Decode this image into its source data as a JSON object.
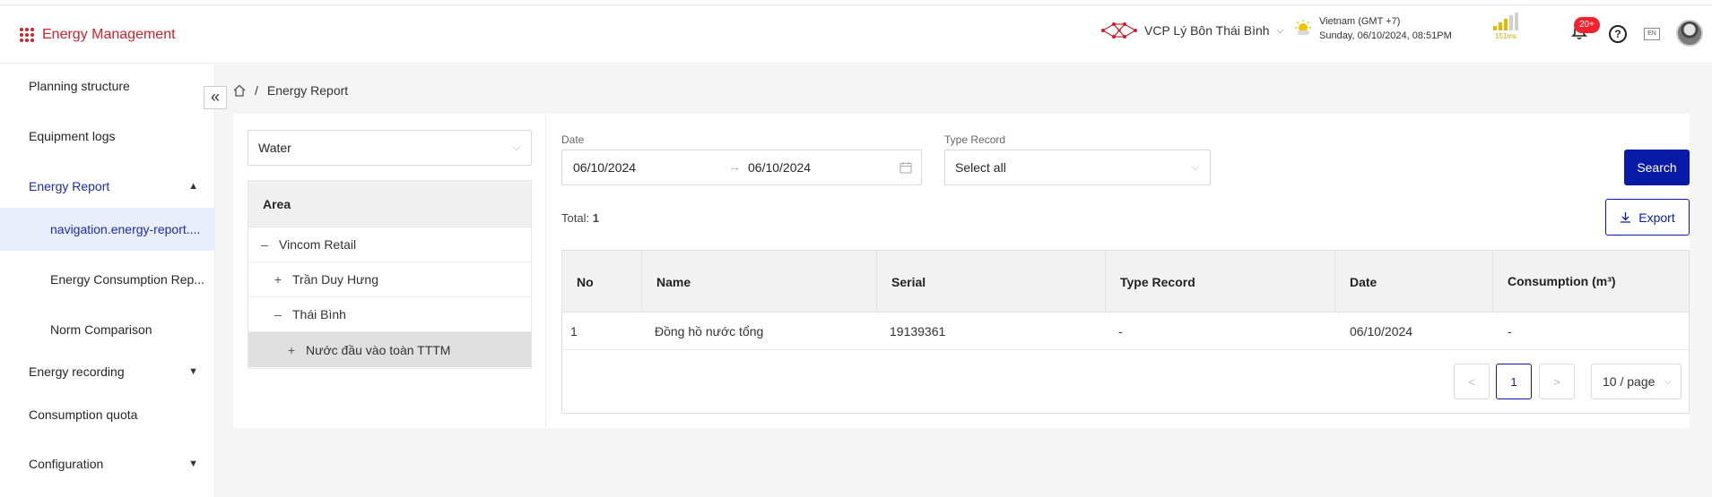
{
  "header": {
    "app_title": "Energy Management",
    "site_name": "VCP Lý Bôn Thái Bình",
    "timezone": "Vietnam (GMT +7)",
    "datetime": "Sunday, 06/10/2024, 08:51PM",
    "latency": "151ms",
    "notification_count": "20+",
    "help_icon": "?",
    "language": "EN"
  },
  "sidebar": {
    "items": [
      {
        "label": "Planning structure"
      },
      {
        "label": "Equipment logs"
      },
      {
        "label": "Energy Report"
      },
      {
        "label": "navigation.energy-report...."
      },
      {
        "label": "Energy Consumption Rep..."
      },
      {
        "label": "Norm Comparison"
      },
      {
        "label": "Energy recording"
      },
      {
        "label": "Consumption quota"
      },
      {
        "label": "Configuration"
      }
    ]
  },
  "breadcrumb": {
    "separator": "/",
    "current": "Energy Report"
  },
  "filters": {
    "energy_type": "Water",
    "tree_header": "Area",
    "tree": [
      {
        "label": "Vincom Retail",
        "toggle": "–"
      },
      {
        "label": "Trần Duy Hưng",
        "toggle": "+"
      },
      {
        "label": "Thái Bình",
        "toggle": "–"
      },
      {
        "label": "Nước đầu vào toàn TTTM",
        "toggle": "+"
      }
    ],
    "date_label": "Date",
    "date_from": "06/10/2024",
    "date_arrow": "→",
    "date_to": "06/10/2024",
    "type_record_label": "Type Record",
    "type_record_value": "Select all"
  },
  "actions": {
    "search": "Search",
    "export": "Export"
  },
  "total": {
    "label": "Total:",
    "value": "1"
  },
  "table": {
    "columns": [
      "No",
      "Name",
      "Serial",
      "Type Record",
      "Date",
      "Consumption (m³)"
    ],
    "rows": [
      [
        "1",
        "Đồng hồ nước tổng",
        "19139361",
        "-",
        "06/10/2024",
        "-"
      ]
    ]
  },
  "pagination": {
    "prev": "<",
    "current": "1",
    "next": ">",
    "page_size": "10 / page"
  },
  "colors": {
    "brand": "#d4202a",
    "primary": "#0a1aa8",
    "accent_text": "#1a2bb5",
    "badge": "#f5222d"
  }
}
